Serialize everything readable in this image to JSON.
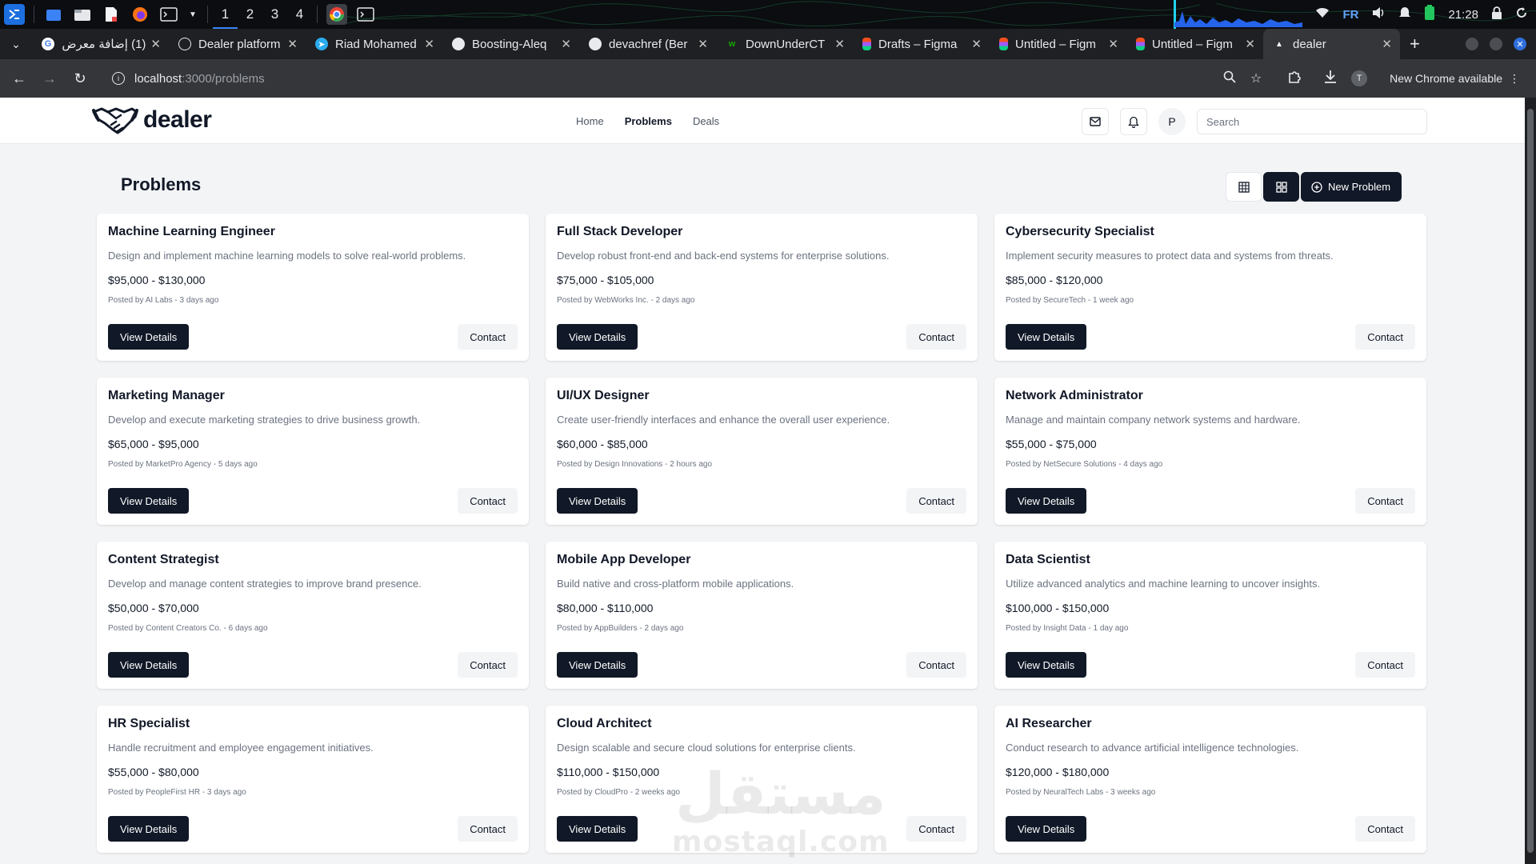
{
  "os_bar": {
    "workspaces": [
      "1",
      "2",
      "3",
      "4"
    ],
    "active_workspace": "1",
    "keyboard_layout": "FR",
    "clock": "21:28",
    "app_icons": [
      "kde-logo-icon",
      "files-icon",
      "folder-icon",
      "document-icon",
      "firefox-icon",
      "terminal-icon",
      "chrome-icon",
      "terminal-icon"
    ]
  },
  "browser": {
    "tabs": [
      {
        "title": "(1) إضافة معرض",
        "icon": "google-icon"
      },
      {
        "title": "Dealer platform",
        "icon": "chatgpt-icon"
      },
      {
        "title": "Riad Mohamed",
        "icon": "telegram-icon"
      },
      {
        "title": "Boosting-Aleq",
        "icon": "github-icon"
      },
      {
        "title": "devachref (Ber",
        "icon": "github-icon"
      },
      {
        "title": "DownUnderCT",
        "icon": "upwork-icon"
      },
      {
        "title": "Drafts – Figma",
        "icon": "figma-icon"
      },
      {
        "title": "Untitled – Figm",
        "icon": "figma-icon"
      },
      {
        "title": "Untitled – Figm",
        "icon": "figma-icon"
      },
      {
        "title": "dealer",
        "icon": "vercel-icon",
        "active": true
      }
    ],
    "url_host": "localhost",
    "url_path": ":3000/problems",
    "update_label": "New Chrome available",
    "profile_initial": "T"
  },
  "site": {
    "logo_text": "dealer",
    "nav": [
      {
        "label": "Home",
        "current": false
      },
      {
        "label": "Problems",
        "current": true
      },
      {
        "label": "Deals",
        "current": false
      }
    ],
    "user_initial": "P",
    "search_placeholder": "Search"
  },
  "page": {
    "title": "Problems",
    "new_button_label": "New Problem"
  },
  "cards": [
    {
      "title": "Machine Learning Engineer",
      "description": "Design and implement machine learning models to solve real-world problems.",
      "salary": "$95,000 - $130,000",
      "meta": "Posted by AI Labs - 3 days ago"
    },
    {
      "title": "Full Stack Developer",
      "description": "Develop robust front-end and back-end systems for enterprise solutions.",
      "salary": "$75,000 - $105,000",
      "meta": "Posted by WebWorks Inc. - 2 days ago"
    },
    {
      "title": "Cybersecurity Specialist",
      "description": "Implement security measures to protect data and systems from threats.",
      "salary": "$85,000 - $120,000",
      "meta": "Posted by SecureTech - 1 week ago"
    },
    {
      "title": "Marketing Manager",
      "description": "Develop and execute marketing strategies to drive business growth.",
      "salary": "$65,000 - $95,000",
      "meta": "Posted by MarketPro Agency - 5 days ago"
    },
    {
      "title": "UI/UX Designer",
      "description": "Create user-friendly interfaces and enhance the overall user experience.",
      "salary": "$60,000 - $85,000",
      "meta": "Posted by Design Innovations - 2 hours ago"
    },
    {
      "title": "Network Administrator",
      "description": "Manage and maintain company network systems and hardware.",
      "salary": "$55,000 - $75,000",
      "meta": "Posted by NetSecure Solutions - 4 days ago"
    },
    {
      "title": "Content Strategist",
      "description": "Develop and manage content strategies to improve brand presence.",
      "salary": "$50,000 - $70,000",
      "meta": "Posted by Content Creators Co. - 6 days ago"
    },
    {
      "title": "Mobile App Developer",
      "description": "Build native and cross-platform mobile applications.",
      "salary": "$80,000 - $110,000",
      "meta": "Posted by AppBuilders - 2 days ago"
    },
    {
      "title": "Data Scientist",
      "description": "Utilize advanced analytics and machine learning to uncover insights.",
      "salary": "$100,000 - $150,000",
      "meta": "Posted by Insight Data - 1 day ago"
    },
    {
      "title": "HR Specialist",
      "description": "Handle recruitment and employee engagement initiatives.",
      "salary": "$55,000 - $80,000",
      "meta": "Posted by PeopleFirst HR - 3 days ago"
    },
    {
      "title": "Cloud Architect",
      "description": "Design scalable and secure cloud solutions for enterprise clients.",
      "salary": "$110,000 - $150,000",
      "meta": "Posted by CloudPro - 2 weeks ago"
    },
    {
      "title": "AI Researcher",
      "description": "Conduct research to advance artificial intelligence technologies.",
      "salary": "$120,000 - $180,000",
      "meta": "Posted by NeuralTech Labs - 3 weeks ago"
    }
  ],
  "card_actions": {
    "primary_label": "View Details",
    "secondary_label": "Contact"
  },
  "watermark": {
    "arabic": "مستقل",
    "latin": "mostaql.com"
  },
  "colors": {
    "primary": "#111827",
    "page_bg": "#f3f4f6",
    "muted_text": "#6b7280"
  }
}
